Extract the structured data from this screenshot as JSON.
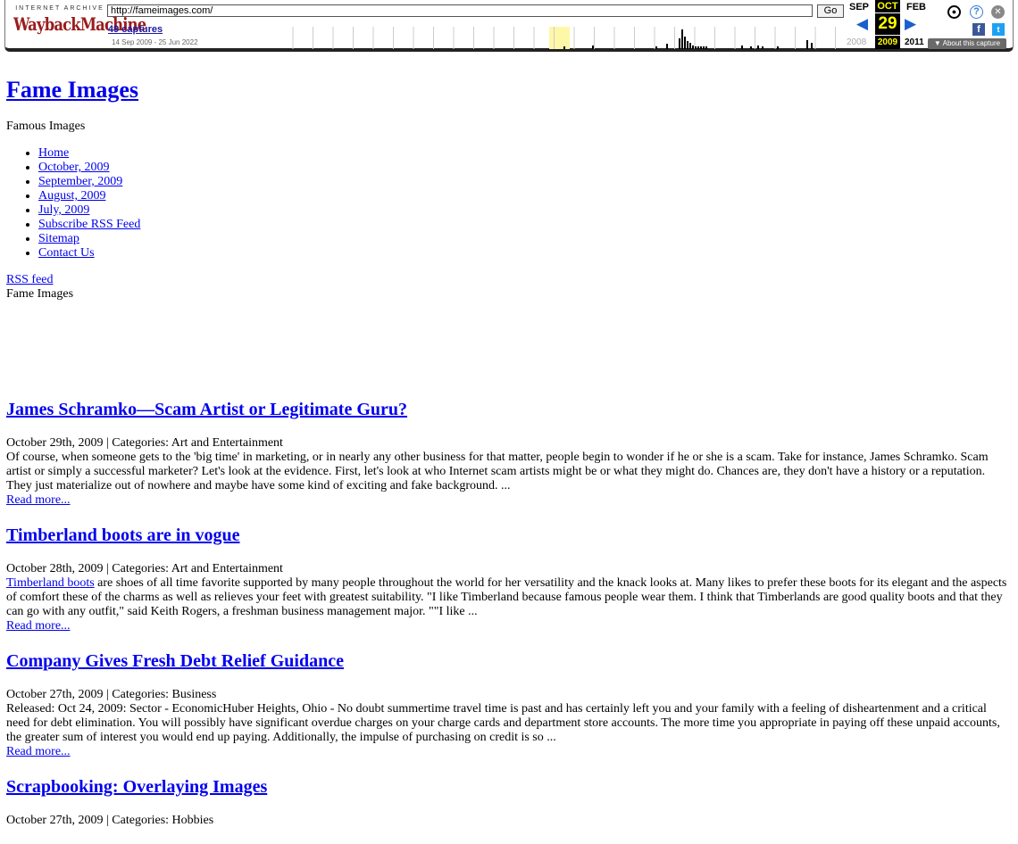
{
  "wayback": {
    "logo_top": "INTERNET ARCHIVE",
    "logo_main": "WaybackMachine",
    "url": "http://fameimages.com/",
    "go_label": "Go",
    "captures": "49 captures",
    "range": "14 Sep 2009 - 25 Jun 2022",
    "prev_month": "SEP",
    "cur_month": "OCT",
    "next_month": "FEB",
    "day": "29",
    "prev_year": "2008",
    "cur_year": "2009",
    "next_year": "2011",
    "about": "▼ About this capture",
    "colors": {
      "accent": "#1a5fcc",
      "highlight": "#fff7a8"
    }
  },
  "site": {
    "title": "Fame Images",
    "description": "Famous Images",
    "nav": [
      "Home",
      "October, 2009",
      "September, 2009",
      "August, 2009",
      "July, 2009",
      "Subscribe RSS Feed",
      "Sitemap",
      "Contact Us"
    ],
    "rss": "RSS feed",
    "subtitle": "Fame Images"
  },
  "posts": [
    {
      "title": "James Schramko—Scam Artist or Legitimate Guru?",
      "meta": "October 29th, 2009 | Categories: Art and Entertainment",
      "link": "",
      "body": "Of course, when someone gets to the 'big time' in marketing, or in nearly any other business for that matter, people begin to wonder if he or she is a scam. Take for instance, James Schramko. Scam artist or simply a successful marketer? Let's look at the evidence. First, let's look at who Internet scam artists might be or what they might do. Chances are, they don't have a history or a reputation. They just materialize out of nowhere and maybe have some kind of exciting and fake background. ...",
      "more": "Read more..."
    },
    {
      "title": "Timberland boots are in vogue",
      "meta": "October 28th, 2009 | Categories: Art and Entertainment",
      "link": "Timberland boots",
      "body": " are shoes of all time favorite supported by many people throughout the world for her versatility and the knack looks at. Many likes to prefer these boots for its elegant and the aspects of comfort these of the charms as well as relieves your feet with greatest suitability. \"I like Timberland because famous people wear them. I think that Timberlands are good quality boots and that they can go with any outfit,\" said Keith Rogers, a freshman business management major. \"\"I like ...",
      "more": "Read more..."
    },
    {
      "title": "Company Gives Fresh Debt Relief Guidance",
      "meta": "October 27th, 2009 | Categories: Business",
      "link": "",
      "body": "Released: Oct 24, 2009: Sector - EconomicHuber Heights, Ohio - No doubt summertime travel time is past and has certainly left you and your family with a feeling of disheartenment and a critical need for debt elimination. You will possibly have significant overdue charges on your charge cards and department store accounts. The more time you appropriate in paying off these unpaid accounts, the greater sum of interest you would end up paying. Additionally, the impulse of purchasing on credit is so ...",
      "more": "Read more..."
    },
    {
      "title": "Scrapbooking: Overlaying Images",
      "meta": "October 27th, 2009 | Categories: Hobbies",
      "link": "",
      "body": "",
      "more": ""
    }
  ]
}
